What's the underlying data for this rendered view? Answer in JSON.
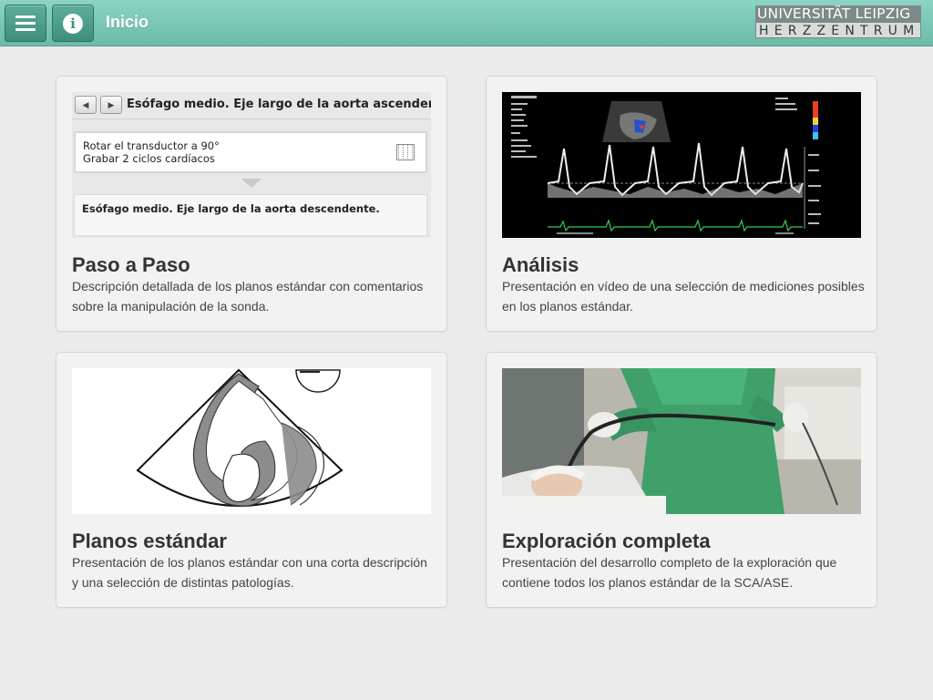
{
  "header": {
    "title": "Inicio",
    "menu_icon": "hamburger-menu-icon",
    "info_icon": "info-icon",
    "info_glyph": "i",
    "logo_top": "UNIVERSITÄT LEIPZIG",
    "logo_bottom": "HERZZENTRUM",
    "accent_color": "#6cbaa8"
  },
  "cards": [
    {
      "title": "Paso a Paso",
      "description": "Descripción detallada de los planos estándar con comentarios sobre la manipulación de la sonda.",
      "preview": {
        "prev_glyph": "◀",
        "next_glyph": "▶",
        "view_title": "Esófago medio. Eje largo de la aorta ascendente.",
        "step_line1": "Rotar el transductor a 90°",
        "step_line2": "Grabar 2 ciclos cardíacos",
        "next_view": "Esófago medio. Eje largo de la aorta descendente."
      }
    },
    {
      "title": "Análisis",
      "description": "Presentación en vídeo de una selección de mediciones posibles en los planos estándar."
    },
    {
      "title": "Planos estándar",
      "description": "Presentación de los planos estándar con una corta descripción y una selección de distintas patologías."
    },
    {
      "title": "Exploración completa",
      "description": "Presentación del desarrollo completo de la exploración que contiene todos los planos estándar de la SCA/ASE."
    }
  ]
}
